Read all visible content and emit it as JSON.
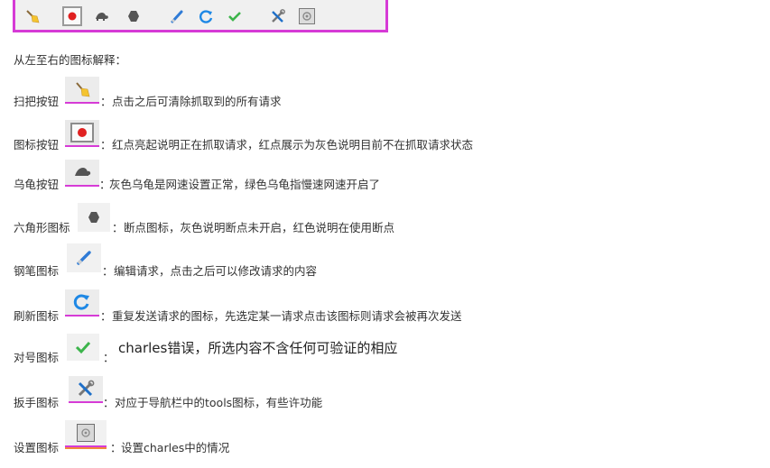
{
  "intro": "从左至右的图标解释：",
  "rows": [
    {
      "label": "扫把按钮",
      "colon": "：",
      "desc": "点击之后可清除抓取到的所有请求",
      "icon": "broom-icon"
    },
    {
      "label": "图标按钮",
      "colon": "：",
      "desc": "红点亮起说明正在抓取请求，红点展示为灰色说明目前不在抓取请求状态",
      "icon": "record-icon"
    },
    {
      "label": "乌龟按钮",
      "colon": "：",
      "desc": "灰色乌龟是网速设置正常，绿色乌龟指慢速网速开启了",
      "icon": "turtle-icon"
    },
    {
      "label": "六角形图标",
      "colon": "：",
      "desc": "断点图标，灰色说明断点未开启，红色说明在使用断点",
      "icon": "hexagon-icon"
    },
    {
      "label": "钢笔图标",
      "colon": "：",
      "desc": "编辑请求，点击之后可以修改请求的内容",
      "icon": "pen-icon"
    },
    {
      "label": "刷新图标",
      "colon": "：",
      "desc": "重复发送请求的图标，先选定某一请求点击该图标则请求会被再次发送",
      "icon": "refresh-icon"
    },
    {
      "label": "对号图标",
      "colon": "：",
      "desc": "charles错误，所选内容不含任何可验证的相应",
      "icon": "check-icon"
    },
    {
      "label": "扳手图标",
      "colon": "：",
      "desc": "对应于导航栏中的tools图标，有些许功能",
      "icon": "tools-icon"
    },
    {
      "label": "设置图标",
      "colon": "：",
      "desc": "设置charles中的情况",
      "icon": "settings-icon"
    }
  ],
  "colors": {
    "highlight": "#d63bd6",
    "record_red": "#e02020",
    "refresh_blue": "#1e88e5",
    "check_green": "#3cb44b"
  }
}
